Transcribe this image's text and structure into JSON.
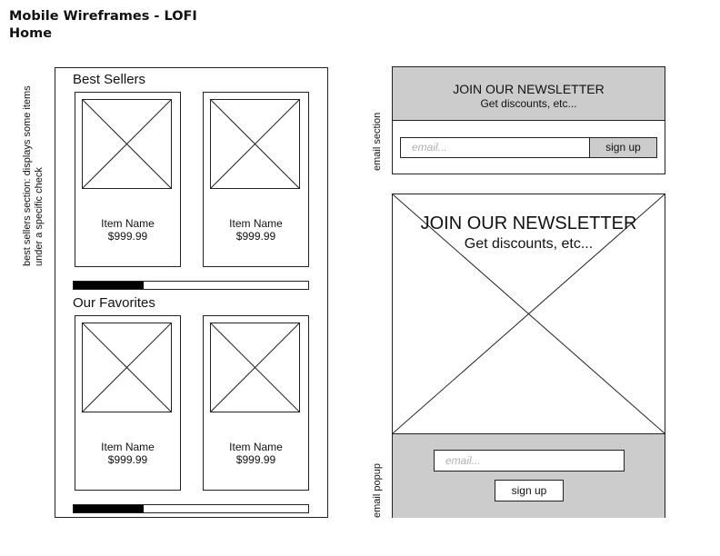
{
  "header": {
    "title": "Mobile Wireframes - LOFI",
    "subtitle": "Home"
  },
  "annotations": {
    "best_sellers_note_line1": "best sellers section: displays some items",
    "best_sellers_note_line2": "under a specific check",
    "email_section_note": "email section",
    "email_popup_note": "email popup"
  },
  "phone": {
    "best_sellers": {
      "heading": "Best Sellers",
      "items": [
        {
          "name": "Item Name",
          "price": "$999.99"
        },
        {
          "name": "Item Name",
          "price": "$999.99"
        }
      ],
      "progress": 0.3
    },
    "favorites": {
      "heading": "Our Favorites",
      "items": [
        {
          "name": "Item Name",
          "price": "$999.99"
        },
        {
          "name": "Item Name",
          "price": "$999.99"
        }
      ],
      "progress": 0.3
    }
  },
  "newsletter_section": {
    "heading": "JOIN OUR NEWSLETTER",
    "subheading": "Get discounts, etc...",
    "email_placeholder": "email...",
    "button_label": "sign up"
  },
  "newsletter_popup": {
    "heading": "JOIN OUR NEWSLETTER",
    "subheading": "Get discounts, etc...",
    "email_placeholder": "email...",
    "button_label": "sign up"
  },
  "colors": {
    "panel_gray": "#cccccc",
    "line": "#222222",
    "progress_fill": "#000000"
  }
}
